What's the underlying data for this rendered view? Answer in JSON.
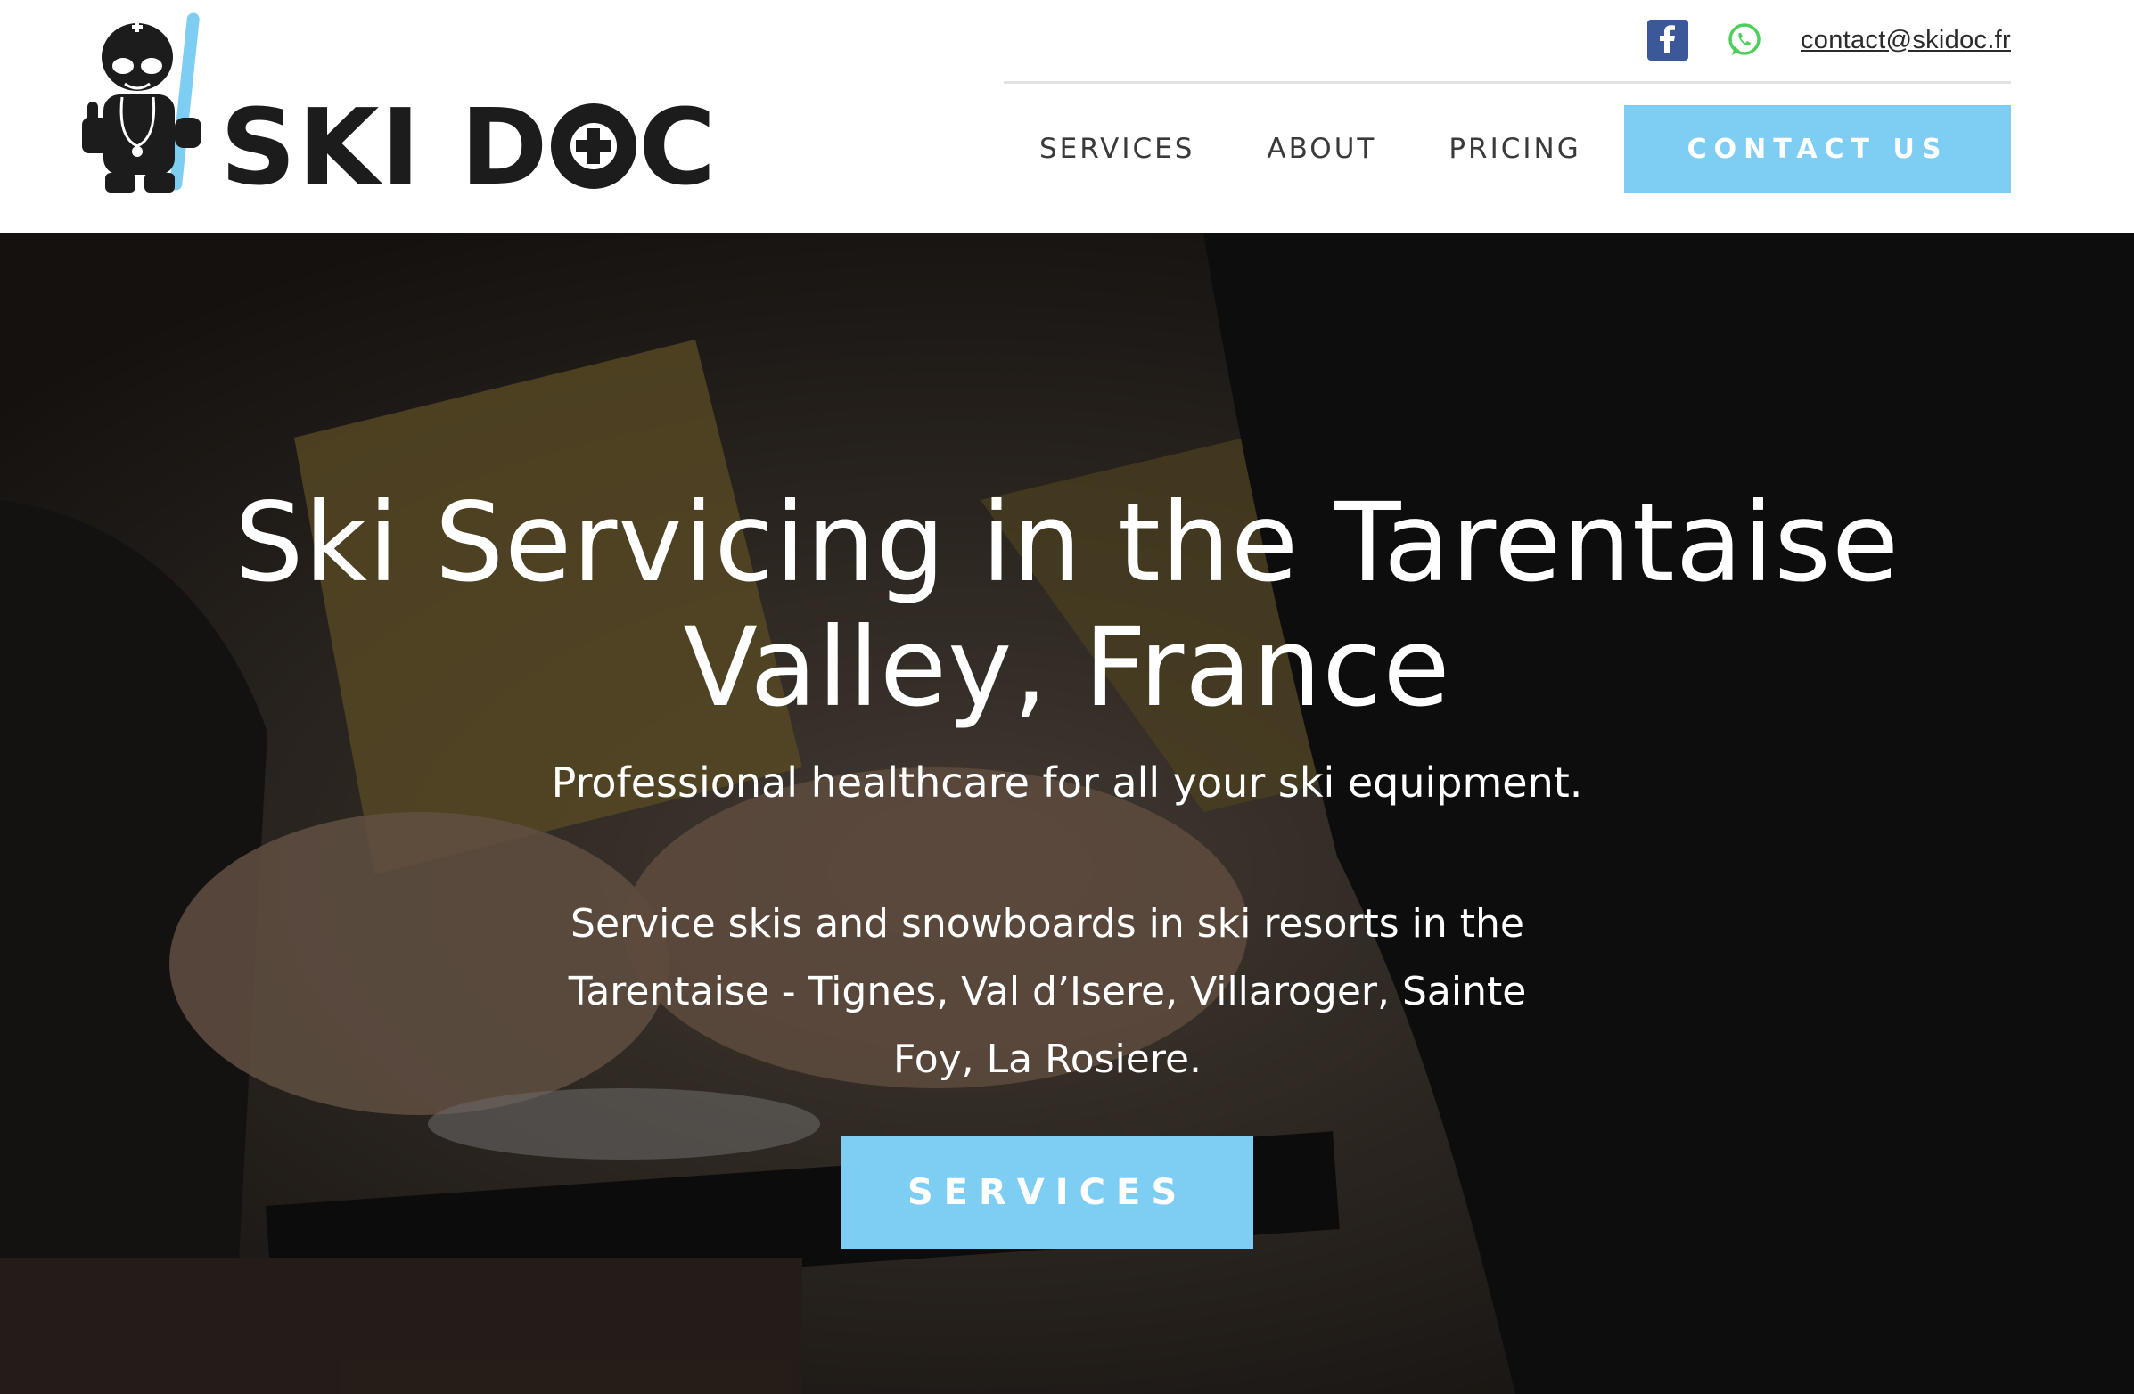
{
  "brand": {
    "name_part1": "SKI D",
    "name_part2": "C",
    "accent_color": "#7ecdf3",
    "dark_color": "#1c1c1c"
  },
  "topbar": {
    "facebook_icon": "facebook-icon",
    "whatsapp_icon": "whatsapp-icon",
    "email": "contact@skidoc.fr"
  },
  "nav": {
    "items": [
      {
        "label": "SERVICES"
      },
      {
        "label": "ABOUT"
      },
      {
        "label": "PRICING"
      }
    ],
    "cta_label": "CONTACT US"
  },
  "hero": {
    "title_line1": "Ski Servicing in the Tarentaise",
    "title_line2": "Valley, France",
    "subtitle": "Professional healthcare for all your ski equipment.",
    "description": "Service skis and snowboards in ski resorts in the Tarentaise - Tignes, Val d’Isere, Villaroger, Sainte Foy, La Rosiere.",
    "button_label": "SERVICES"
  }
}
